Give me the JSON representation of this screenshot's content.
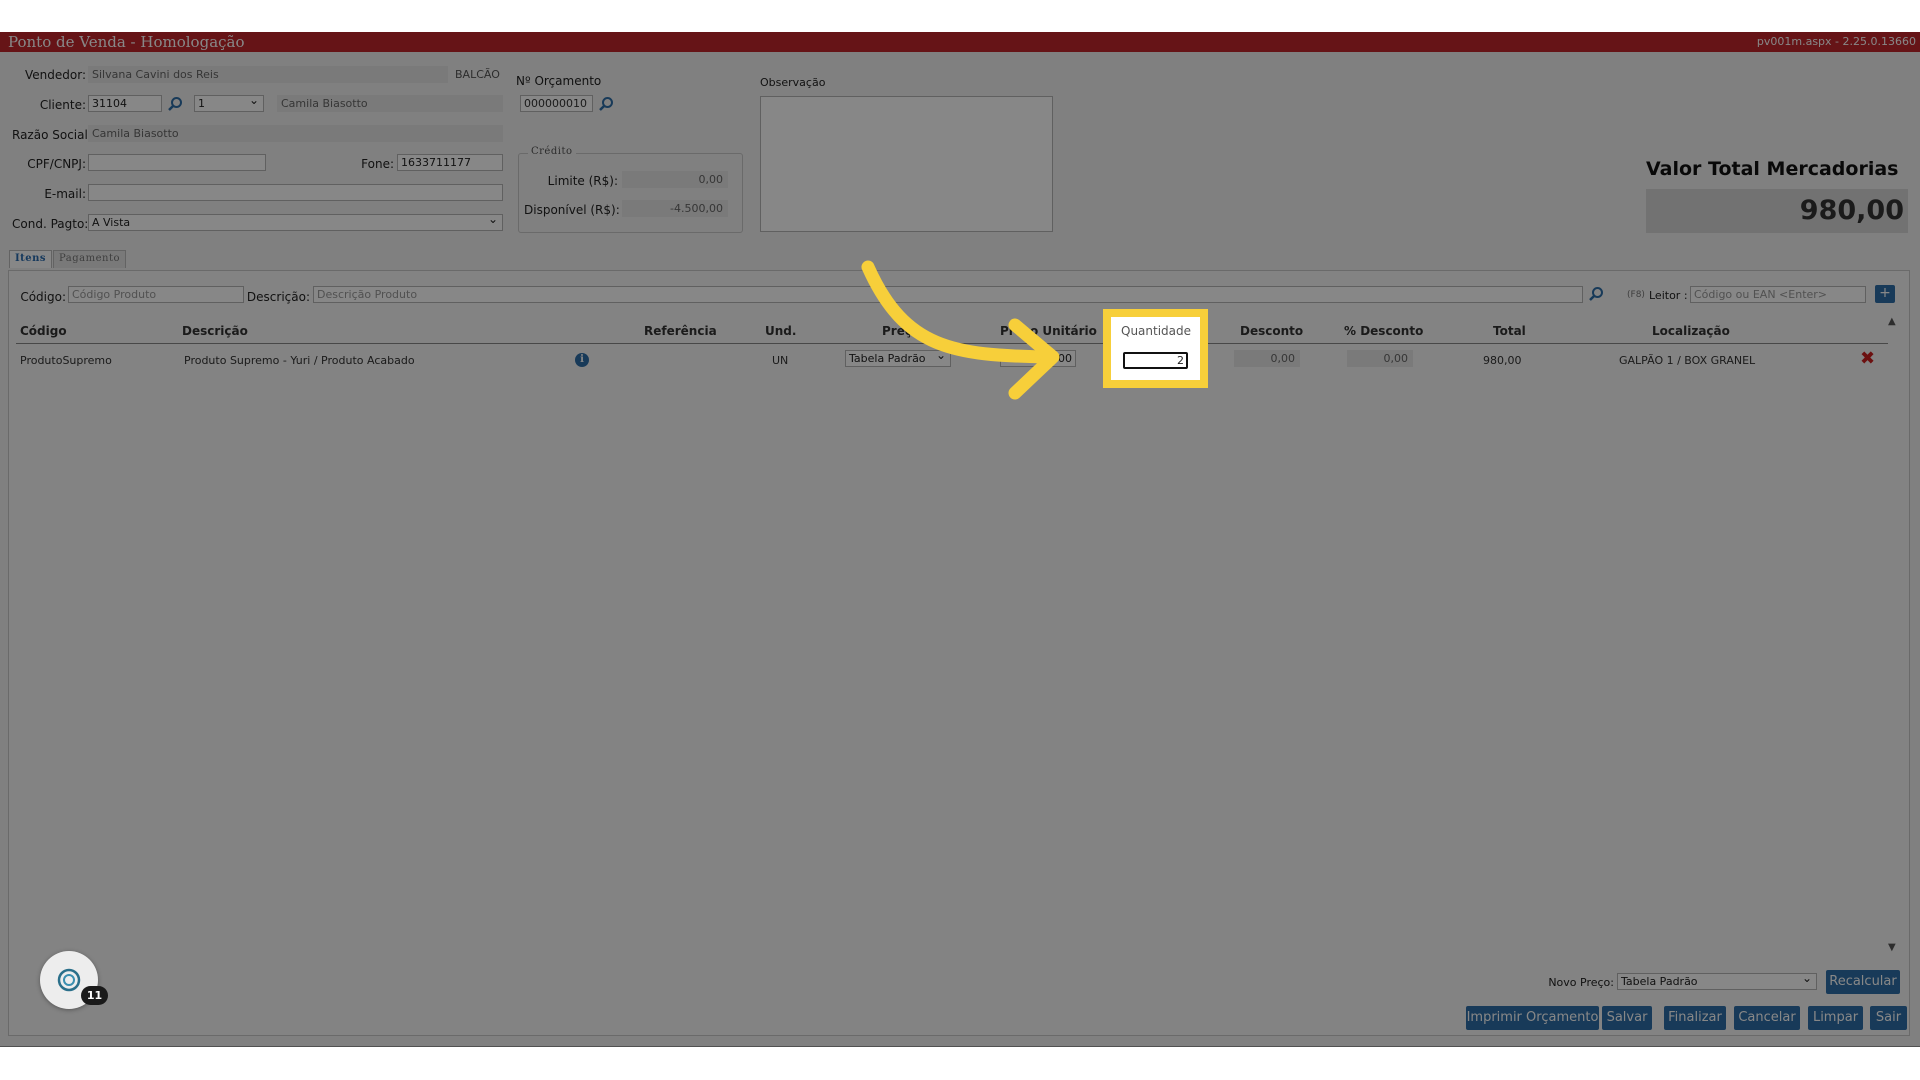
{
  "window": {
    "title": "Ponto de Venda  - Homologação",
    "version": "pv001m.aspx - 2.25.0.13660"
  },
  "header": {
    "vendedor_label": "Vendedor:",
    "vendedor_value": "Silvana Cavini dos Reis",
    "balcao": "BALCÃO",
    "cliente_label": "Cliente:",
    "cliente_code": "31104",
    "cliente_seq": "1",
    "cliente_name": "Camila Biasotto",
    "razao_label": "Razão Social:",
    "razao_value": "Camila Biasotto",
    "cpf_label": "CPF/CNPJ:",
    "cpf_value": "",
    "fone_label": "Fone:",
    "fone_value": "1633711177",
    "email_label": "E-mail:",
    "email_value": "",
    "cond_label": "Cond. Pagto:",
    "cond_value": "A Vista",
    "orcamento_label": "Nº Orçamento",
    "orcamento_value": "000000010",
    "credito_legend": "Crédito",
    "limite_label": "Limite (R$):",
    "limite_value": "0,00",
    "disponivel_label": "Disponível (R$):",
    "disponivel_value": "-4.500,00",
    "observacao_label": "Observação",
    "total_label": "Valor Total Mercadorias",
    "total_value": "980,00"
  },
  "tabs": [
    {
      "label": "Itens"
    },
    {
      "label": "Pagamento"
    }
  ],
  "search": {
    "codigo_label": "Código:",
    "codigo_placeholder": "Código Produto",
    "descricao_label": "Descrição:",
    "descricao_placeholder": "Descrição Produto",
    "f8": "(F8)",
    "leitor_label": "Leitor :",
    "leitor_placeholder": "Código ou EAN <Enter>",
    "add": "+"
  },
  "table": {
    "headers": [
      "Código",
      "Descrição",
      "Referência",
      "Und.",
      "Preço",
      "Preço Unitário",
      "Quantidade",
      "Desconto",
      "% Desconto",
      "Total",
      "Localização"
    ],
    "row": {
      "codigo": "ProdutoSupremo",
      "descricao": "Produto Supremo - Yuri / Produto Acabado",
      "referencia": "",
      "und": "UN",
      "preco": "Tabela Padrão",
      "preco_unitario": "490,00",
      "quantidade": "2",
      "desconto": "0,00",
      "pct_desconto": "0,00",
      "total": "980,00",
      "localizacao": "GALPÃO 1 / BOX GRANEL"
    }
  },
  "footer": {
    "novo_preco_label": "Novo Preço:",
    "novo_preco_value": "Tabela Padrão",
    "recalcular": "Recalcular",
    "buttons": [
      "Imprimir Orçamento",
      "Salvar",
      "Finalizar",
      "Cancelar",
      "Limpar",
      "Sair"
    ],
    "badge_count": "11"
  },
  "colors": {
    "title_bar": "#c0272d",
    "button": "#2f6fa8",
    "highlight": "#f7cf3a"
  }
}
